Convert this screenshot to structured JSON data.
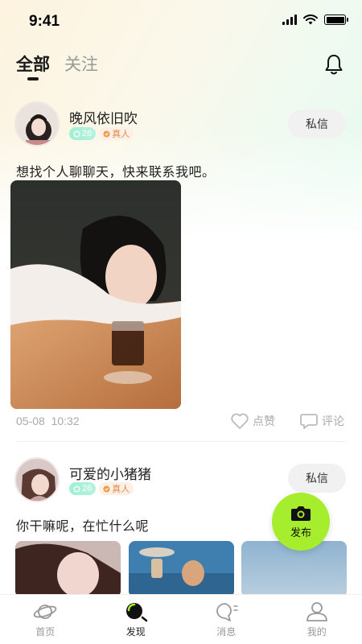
{
  "status": {
    "time": "9:41"
  },
  "tabs": [
    {
      "label": "全部"
    },
    {
      "label": "关注"
    }
  ],
  "posts": [
    {
      "username": "晚风依旧吹",
      "age": "26",
      "verified": "真人",
      "dm_label": "私信",
      "text": "想找个人聊聊天，快来联系我吧。",
      "date": "05-08",
      "time": "10:32",
      "like_label": "点赞",
      "comment_label": "评论"
    },
    {
      "username": "可爱的小猪猪",
      "age": "26",
      "verified": "真人",
      "dm_label": "私信",
      "text": "你干嘛呢，在忙什么呢"
    }
  ],
  "fab": {
    "label": "发布"
  },
  "tabbar": [
    {
      "label": "首页",
      "icon": "planet-icon"
    },
    {
      "label": "发现",
      "icon": "discover-icon"
    },
    {
      "label": "消息",
      "icon": "message-icon"
    },
    {
      "label": "我的",
      "icon": "profile-icon"
    }
  ],
  "colors": {
    "accent": "#a6ee2d",
    "badge_age": "#9ff0d0",
    "badge_real": "#e08a4a"
  }
}
